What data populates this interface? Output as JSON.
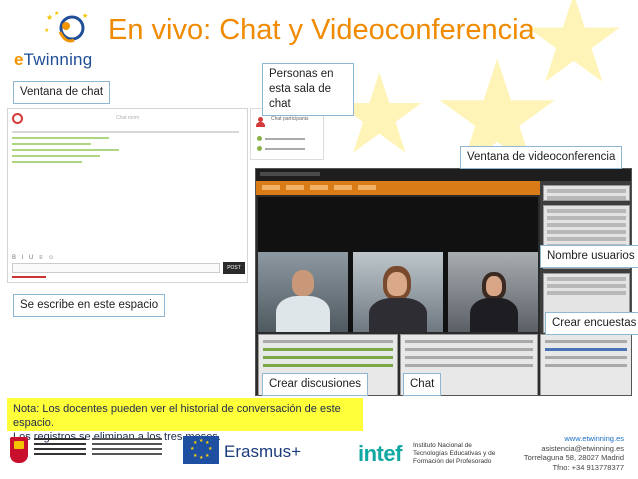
{
  "header": {
    "logo_text_e": "e",
    "logo_text_rest": "Twinning",
    "title": "En vivo: Chat y Videoconferencia"
  },
  "callouts": {
    "chat_window": "Ventana de chat",
    "people_line1": "Personas en",
    "people_line2": "esta sala de chat",
    "video_window": "Ventana de videoconferencia",
    "user_names": "Nombre usuarios",
    "write_here": "Se escribe en este espacio",
    "create_polls": "Crear encuestas",
    "create_discussions": "Crear discusiones",
    "chat": "Chat"
  },
  "chat_window": {
    "room_title": "Chat room",
    "toolbar": "B I U ≡ ☺",
    "post_button": "POST"
  },
  "participants_panel": {
    "title": "Chat participants"
  },
  "note": {
    "line1": "Nota: Los docentes pueden ver el historial de conversación de este espacio.",
    "line2": "Los registros se eliminan a los tres meses."
  },
  "footer": {
    "erasmus": "Erasmus+",
    "intef": "intef",
    "intef_desc": "Instituto Nacional de Tecnologías Educativas y de Formación del Profesorado",
    "web": "www.etwinning.es",
    "email": "asistencia@etwinning.es",
    "address": "Torrelaguna 58, 28027 Madrid",
    "phone": "Tfno: +34 913778377"
  },
  "colors": {
    "title_orange": "#f08a00",
    "callout_border": "#8fb6d3",
    "note_yellow": "#ffff3a",
    "video_toolbar": "#d97c18",
    "intef_teal": "#11a7a2"
  }
}
